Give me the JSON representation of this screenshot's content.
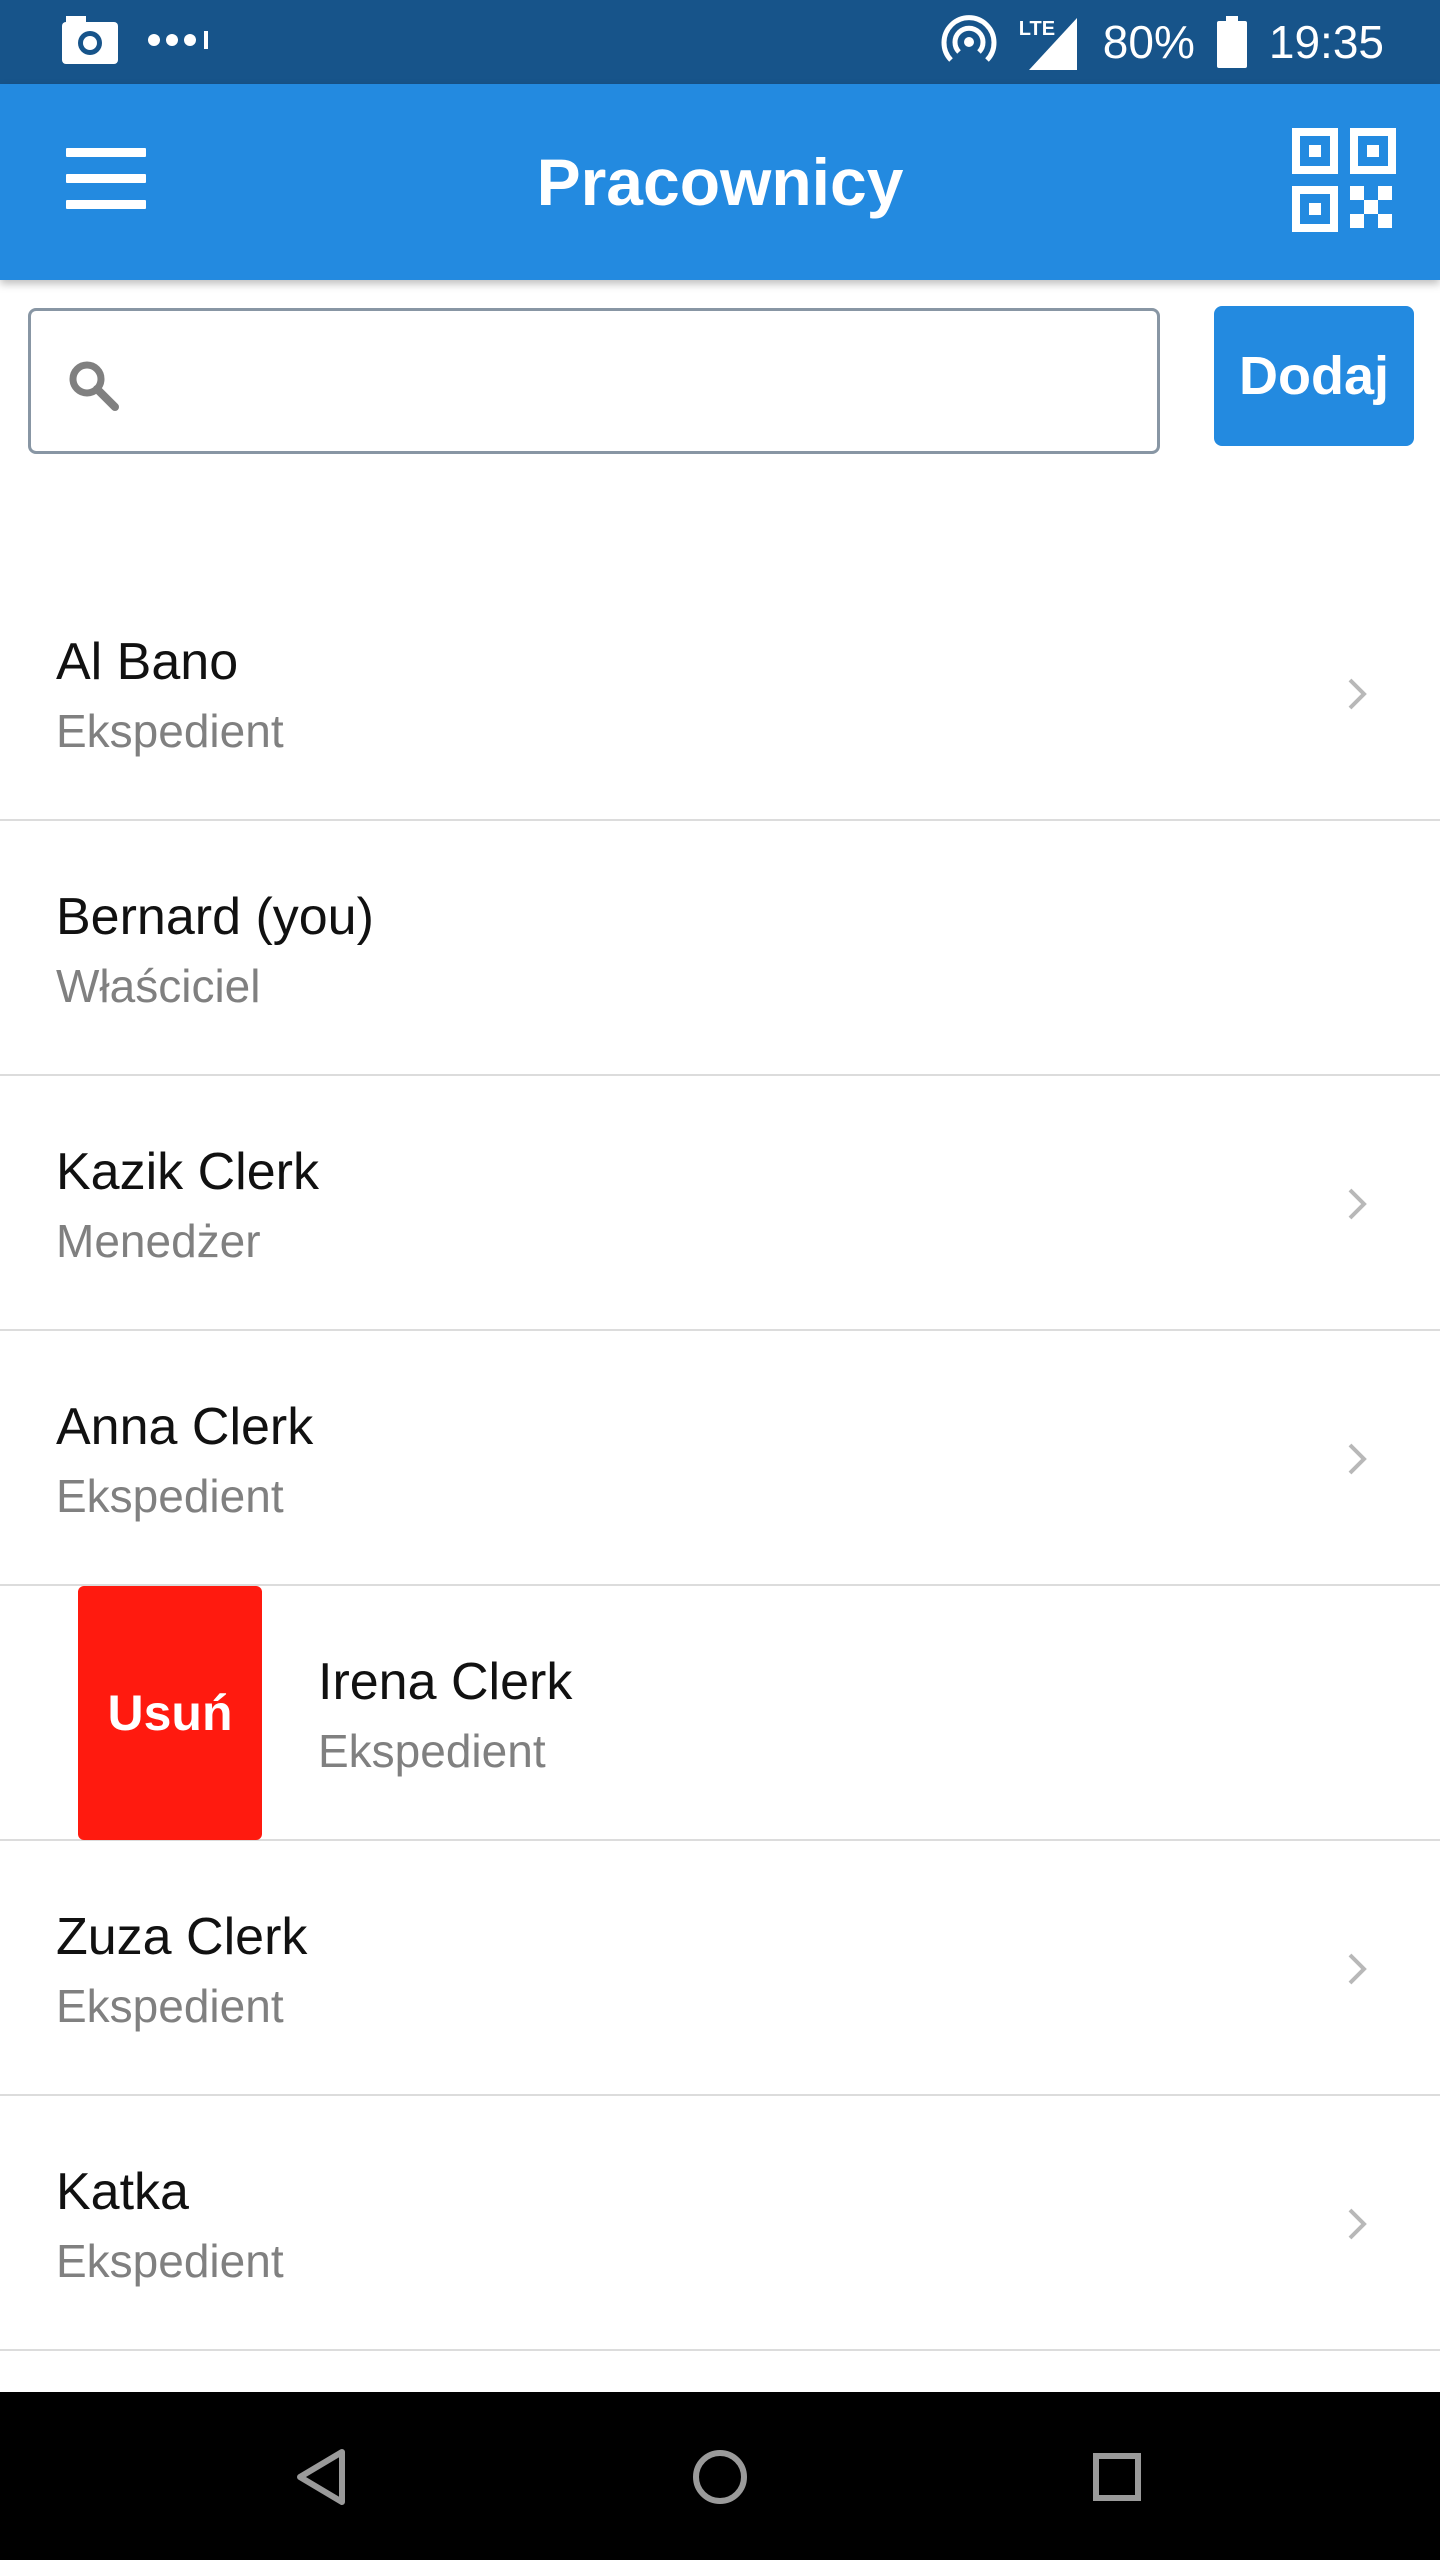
{
  "status_bar": {
    "battery": "80%",
    "time": "19:35",
    "network": "LTE",
    "icons": [
      "camera-icon",
      "dots-icon",
      "hotspot-icon",
      "signal-icon",
      "battery-icon"
    ]
  },
  "app_bar": {
    "title": "Pracownicy",
    "menu_icon": "hamburger-menu-icon",
    "qr_icon": "qr-code-icon"
  },
  "search": {
    "value": "",
    "placeholder": "",
    "icon": "search-icon"
  },
  "add_button_label": "Dodaj",
  "employees": [
    {
      "name": "Al Bano",
      "role": "Ekspedient",
      "chevron": true
    },
    {
      "name": "Bernard (you)",
      "role": "Właściciel",
      "chevron": false
    },
    {
      "name": "Kazik Clerk",
      "role": "Menedżer",
      "chevron": true
    },
    {
      "name": "Anna Clerk",
      "role": "Ekspedient",
      "chevron": true
    },
    {
      "name": "Irena Clerk",
      "role": "Ekspedient",
      "chevron": false,
      "delete_label": "Usuń"
    },
    {
      "name": "Zuza Clerk",
      "role": "Ekspedient",
      "chevron": true
    },
    {
      "name": "Katka",
      "role": "Ekspedient",
      "chevron": true
    }
  ],
  "colors": {
    "status_bar": "#17548a",
    "primary": "#238ae0",
    "delete": "#ff1a0f",
    "secondary_text": "#808080"
  },
  "nav_bar": {
    "icons": [
      "back-icon",
      "home-icon",
      "recents-icon"
    ]
  }
}
